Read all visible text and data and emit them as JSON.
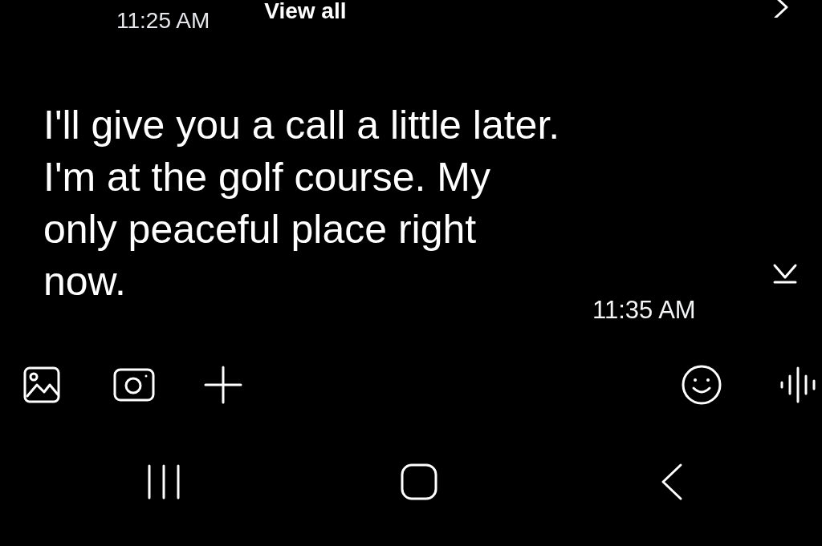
{
  "previous_message": {
    "time": "11:25 AM",
    "link": "View all"
  },
  "message": {
    "text": "I'll give you a call a little later. I'm at the golf course. My only peaceful place right now.",
    "time": "11:35 AM"
  }
}
